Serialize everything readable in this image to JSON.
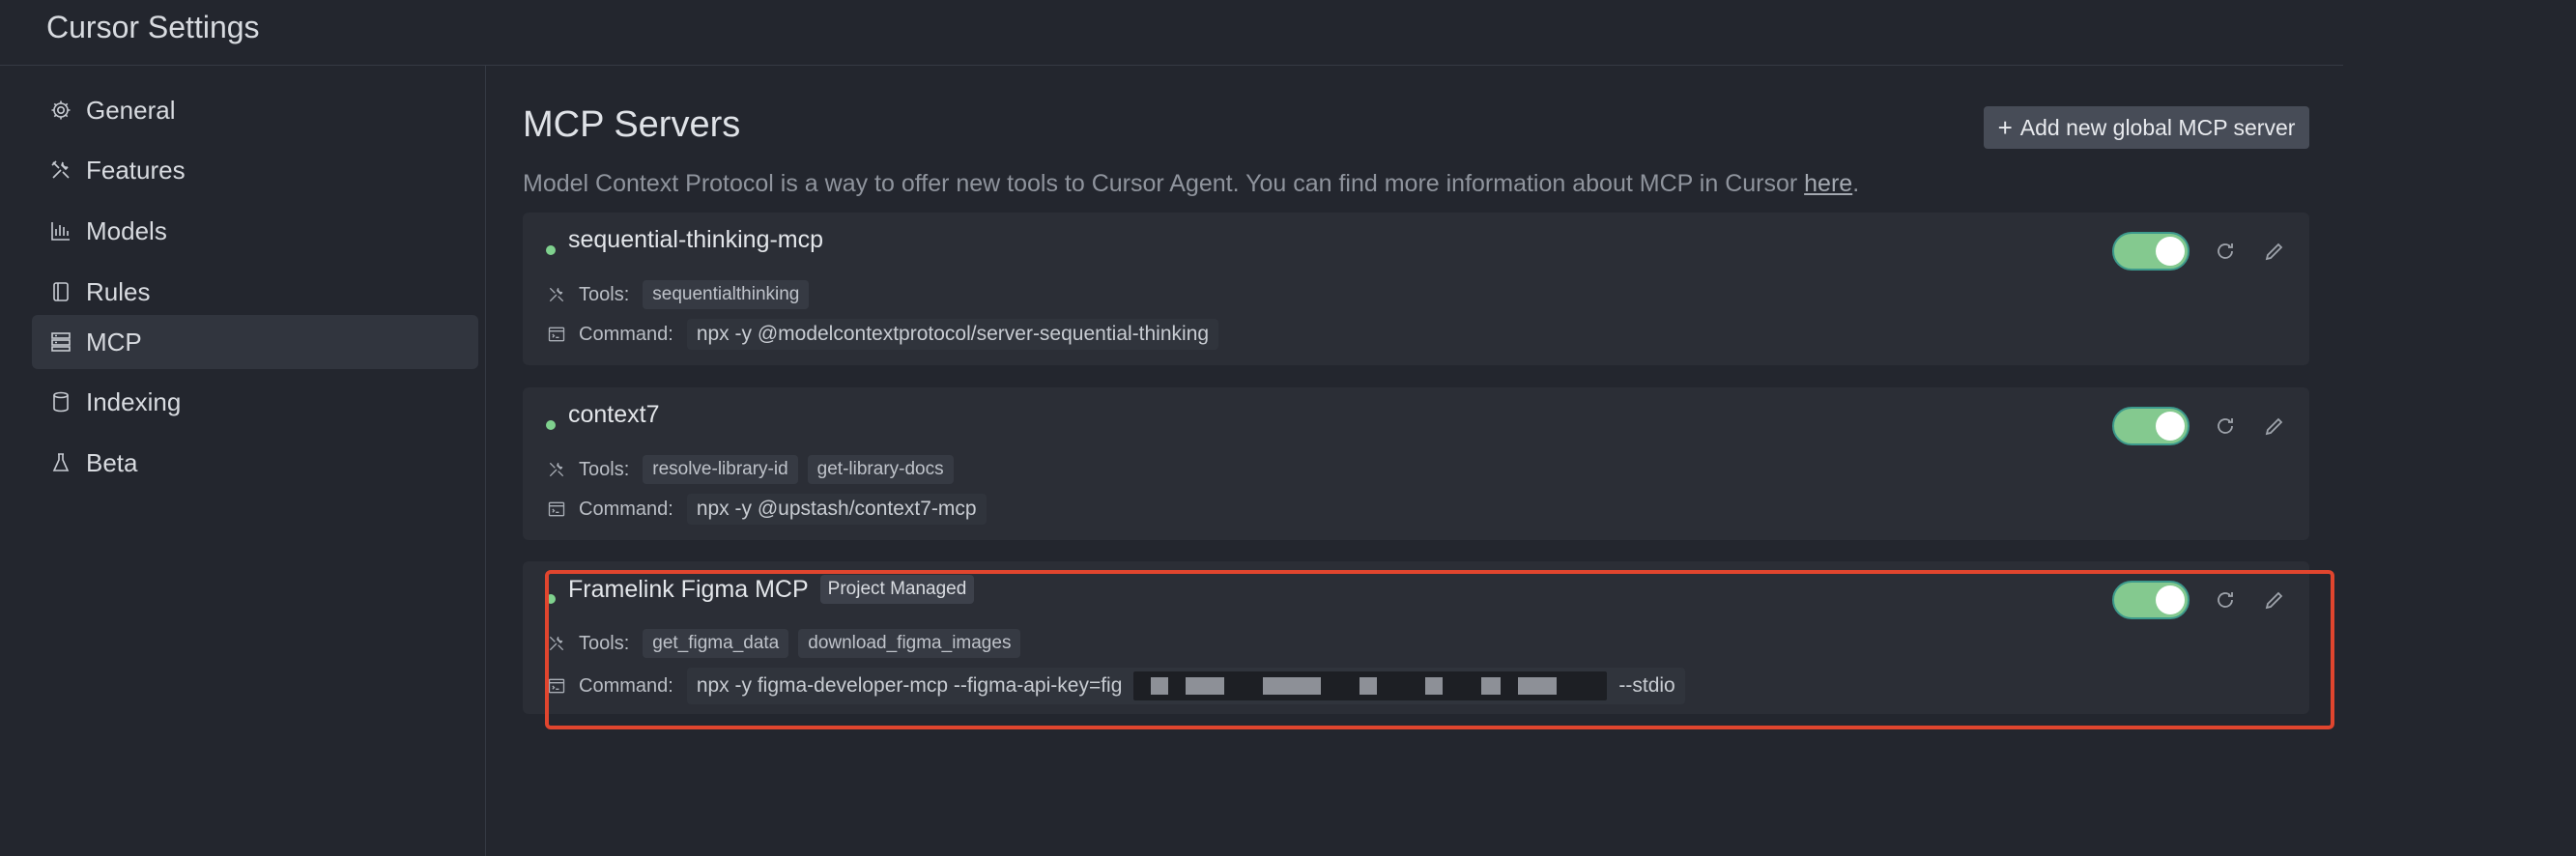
{
  "app": {
    "title": "Cursor Settings"
  },
  "sidebar": {
    "items": [
      {
        "label": "General",
        "icon": "gear-icon"
      },
      {
        "label": "Features",
        "icon": "tools-icon"
      },
      {
        "label": "Models",
        "icon": "bar-chart-icon"
      },
      {
        "label": "Rules",
        "icon": "book-icon"
      },
      {
        "label": "MCP",
        "icon": "server-icon",
        "active": true
      },
      {
        "label": "Indexing",
        "icon": "database-icon"
      },
      {
        "label": "Beta",
        "icon": "flask-icon"
      }
    ]
  },
  "main": {
    "title": "MCP Servers",
    "add_button_label": "Add new global MCP server",
    "description_prefix": "Model Context Protocol is a way to offer new tools to Cursor Agent. You can find more information about MCP in Cursor ",
    "description_link": "here",
    "description_suffix": ".",
    "tools_label": "Tools:",
    "command_label": "Command:",
    "servers": [
      {
        "name": "sequential-thinking-mcp",
        "status_color": "#7fd18e",
        "enabled": true,
        "tools": [
          "sequentialthinking"
        ],
        "command": "npx -y @modelcontextprotocol/server-sequential-thinking"
      },
      {
        "name": "context7",
        "status_color": "#7fd18e",
        "enabled": true,
        "tools": [
          "resolve-library-id",
          "get-library-docs"
        ],
        "command": "npx -y @upstash/context7-mcp"
      },
      {
        "name": "Framelink Figma MCP",
        "badge": "Project Managed",
        "status_color": "#7fd18e",
        "enabled": true,
        "tools": [
          "get_figma_data",
          "download_figma_images"
        ],
        "command_prefix": "npx -y figma-developer-mcp --figma-api-key=fig",
        "command_suffix": "--stdio"
      }
    ]
  },
  "colors": {
    "background": "#23262e",
    "card": "#2b2e36",
    "toggle_on": "#84c98f",
    "highlight": "#e0452e"
  }
}
